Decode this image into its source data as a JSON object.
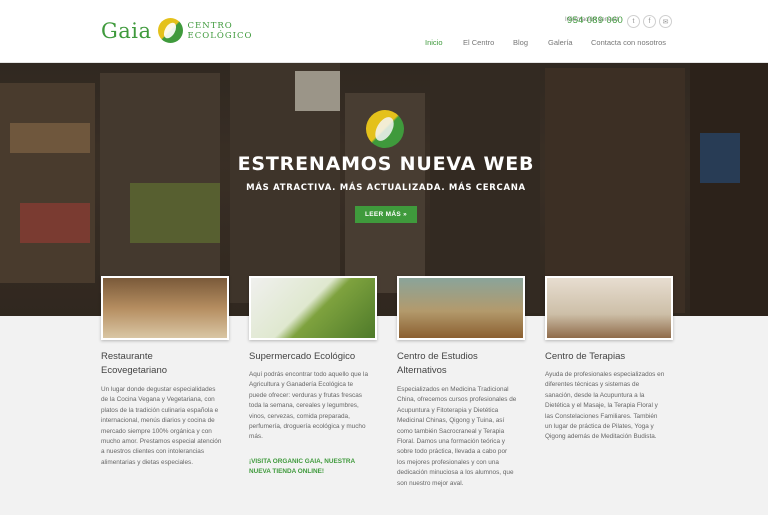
{
  "header": {
    "logo_word": "Gaia",
    "logo_sub_1": "CENTRO",
    "logo_sub_2": "ECOLÓGICO",
    "info_label": "Información general",
    "phone": "954 089 060",
    "social": [
      {
        "icon": "twitter-icon",
        "glyph": "t"
      },
      {
        "icon": "facebook-icon",
        "glyph": "f"
      },
      {
        "icon": "mail-icon",
        "glyph": "✉"
      }
    ],
    "nav": [
      "Inicio",
      "El Centro",
      "Blog",
      "Galería",
      "Contacta con nosotros"
    ],
    "active_nav": "Inicio"
  },
  "hero": {
    "title": "ESTRENAMOS NUEVA WEB",
    "subtitle": "MÁS ATRACTIVA. MÁS ACTUALIZADA. MÁS CERCANA",
    "button": "LEER MÁS »"
  },
  "cards": [
    {
      "title_1": "Restaurante",
      "title_2": "Ecovegetariano",
      "text": [
        "Un lugar donde degustar especialidades",
        "de la Cocina Vegana y Vegetariana, con",
        "platos de la tradición culinaria española e",
        "internacional, menús diarios y cocina de",
        "mercado siempre 100% orgánica y con",
        "mucho amor. Prestamos especial atención",
        "a nuestros clientes con intolerancias",
        "alimentarias y dietas especiales."
      ]
    },
    {
      "title_1": "Supermercado Ecológico",
      "text": [
        "Aquí podrás encontrar todo aquello que la",
        "Agricultura y Ganadería Ecológica te",
        "puede ofrecer: verduras y frutas frescas",
        "toda la semana, cereales y legumbres,",
        "vinos, cervezas, comida preparada,",
        "perfumería, droguería ecológica y mucho",
        "más."
      ],
      "link_1": "¡VISITA ORGANIC GAIA, NUESTRA",
      "link_2": "NUEVA TIENDA ONLINE!"
    },
    {
      "title_1": "Centro de Estudios",
      "title_2": "Alternativos",
      "text": [
        "Especializados en Medicina Tradicional",
        "China, ofrecemos cursos profesionales de",
        "Acupuntura y Fitoterapia y Dietética",
        "Medicinal Chinas, Qigong y Tuina, así",
        "como también Sacrocraneal y Terapia",
        "Floral. Damos una formación teórica y",
        "sobre todo práctica, llevada a cabo por",
        "los mejores profesionales y con una",
        "dedicación minuciosa a los alumnos, que",
        "son nuestro mejor aval."
      ]
    },
    {
      "title_1": "Centro de Terapias",
      "text": [
        "Ayuda de profesionales especializados en",
        "diferentes técnicas y sistemas de",
        "sanación, desde la Acupuntura a la",
        "Dietética y el Masaje, la Terapia Floral y",
        "las Constelaciones Familiares. También",
        "un lugar de práctica de Pilates, Yoga y",
        "Qigong además de Meditación Budista."
      ]
    }
  ],
  "colors": {
    "brand_green": "#3f9a3c",
    "brand_yellow": "#e4c11b"
  }
}
